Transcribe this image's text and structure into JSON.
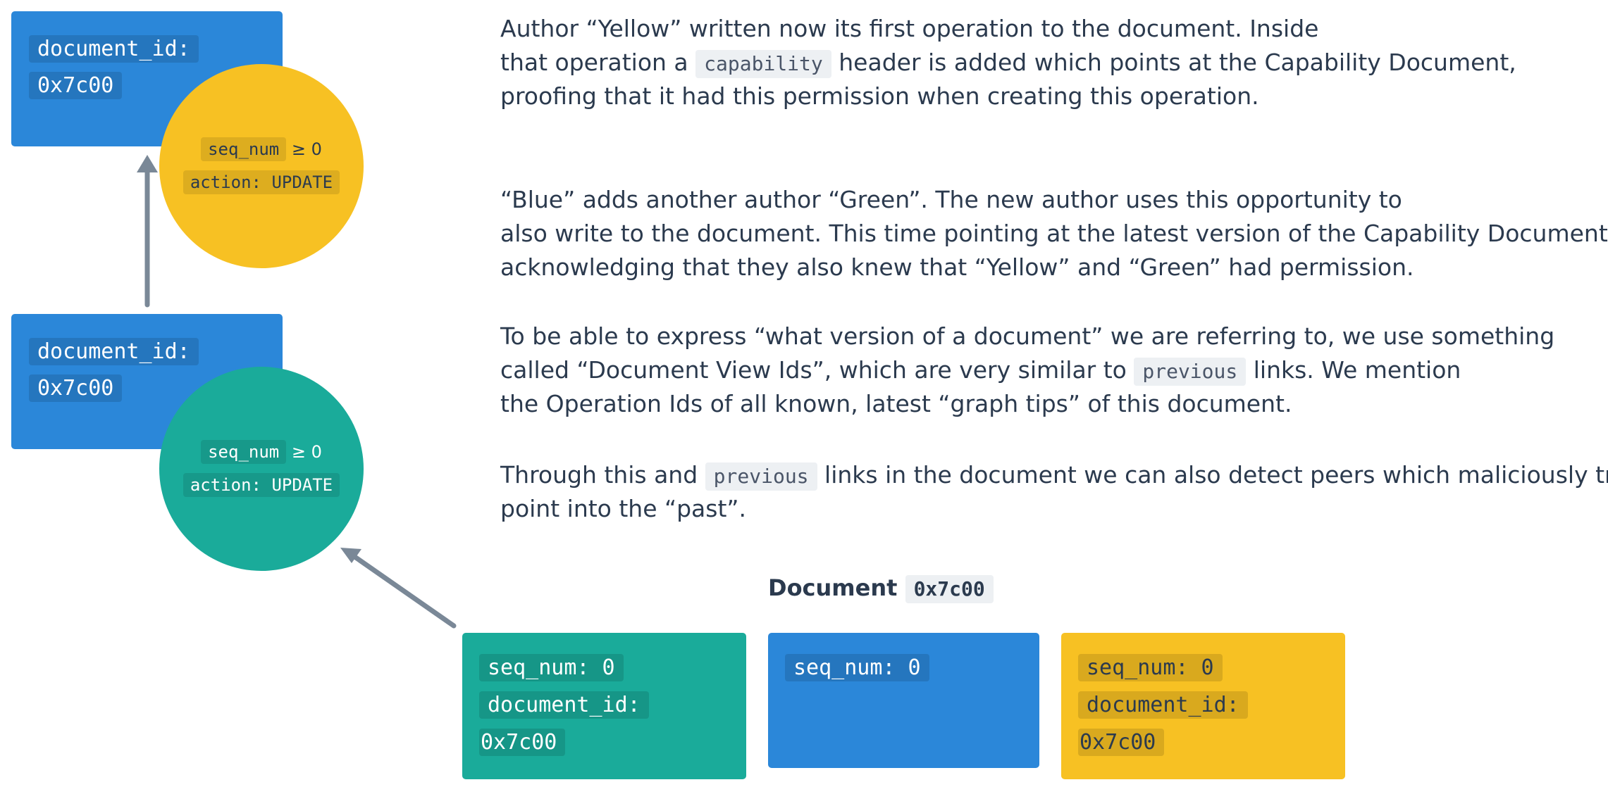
{
  "left_stack": {
    "top_card": {
      "document_id_label": "document_id:",
      "document_id_value": "0x7c00",
      "circle": {
        "seq_num_label": "seq_num",
        "seq_num_op": "≥ 0",
        "action_text": "action: UPDATE",
        "color": "#f7c123"
      }
    },
    "bottom_card": {
      "document_id_label": "document_id:",
      "document_id_value": "0x7c00",
      "circle": {
        "seq_num_label": "seq_num",
        "seq_num_op": "≥ 0",
        "action_text": "action: UPDATE",
        "color": "#1aab9a"
      }
    },
    "card_color": "#2b87d9"
  },
  "paragraphs": {
    "p1": {
      "line1": "Author “Yellow” written now its first operation to the document. Inside",
      "line2_before": "that operation a",
      "line2_code": "capability",
      "line2_after": "header is added which points at the Capability Document,",
      "line3": "proofing that it had this permission when creating this operation."
    },
    "p2": {
      "line1": "“Blue” adds another author “Green”. The new author uses this opportunity to",
      "line2": "also write to the document. This time pointing at the latest version of the Capability Document,",
      "line3": "acknowledging that they also knew that “Yellow” and “Green” had permission."
    },
    "p3": {
      "line1": "To be able to express “what version of a document” we are referring to, we use something",
      "line2_before": "called “Document View Ids”, which are very similar to",
      "line2_code": "previous",
      "line2_after": "links. We mention",
      "line3": "the Operation Ids of all known, latest “graph tips” of this document."
    },
    "p4": {
      "line1_before": "Through this and",
      "line1_code": "previous",
      "line1_after": "links in the document we can also detect peers which maliciously try to",
      "line2": "point into the “past”."
    }
  },
  "document": {
    "title": "Document",
    "id": "0x7c00",
    "operations": [
      {
        "seq_num": "seq_num: 0",
        "document_id_label": "document_id:",
        "document_id_value": "0x7c00",
        "color": "#1aab9a"
      },
      {
        "seq_num": "seq_num: 0",
        "color": "#2b87d9"
      },
      {
        "seq_num": "seq_num: 0",
        "document_id_label": "document_id:",
        "document_id_value": "0x7c00",
        "color": "#f7c123"
      }
    ]
  },
  "colors": {
    "arrow": "#7a8897",
    "text": "#2b3a4e"
  }
}
